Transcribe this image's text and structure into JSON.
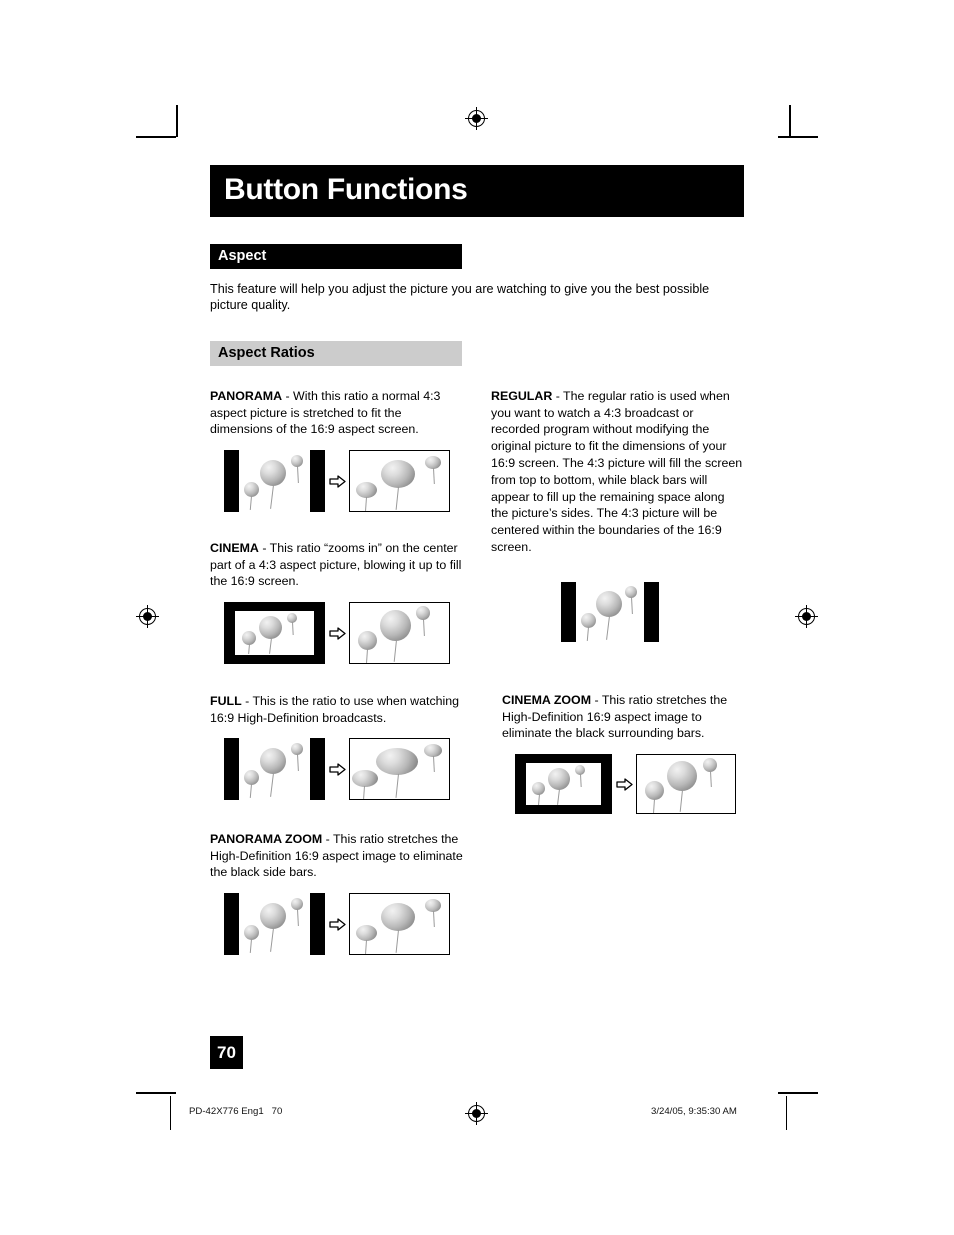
{
  "document": {
    "title": "Button Functions",
    "page_number": "70"
  },
  "sections": {
    "aspect_heading": "Aspect",
    "aspect_intro": "This feature will help you adjust the picture you are watching to give you the best possible picture quality.",
    "aspect_ratios_heading": "Aspect Ratios"
  },
  "ratios": {
    "panorama": {
      "term": "PANORAMA",
      "body": " - With this ratio a normal 4:3 aspect picture is stretched to fit the dimensions of the 16:9 aspect screen."
    },
    "cinema": {
      "term": "CINEMA",
      "body": " - This ratio “zooms in” on the center part of a 4:3 aspect picture, blowing it up to fill the 16:9 screen."
    },
    "full": {
      "term": "FULL",
      "body": " - This is the ratio to use when watching 16:9 High-Definition broadcasts."
    },
    "panorama_zoom": {
      "term": "PANORAMA ZOOM",
      "body": " - This ratio stretches the High-Definition 16:9 aspect image to eliminate the black side bars."
    },
    "regular": {
      "term": "REGULAR",
      "body": " - The regular ratio is used when you want to watch a 4:3 broadcast or recorded program without modifying the original picture to fit the dimensions of your 16:9 screen. The 4:3 picture will fill the screen from top to bottom, while black bars will appear to fill up the remaining space along the picture’s sides. The 4:3 picture will be centered within the boundaries of the 16:9 screen."
    },
    "cinema_zoom": {
      "term": "CINEMA ZOOM",
      "body": " - This ratio stretches the High-Definition 16:9 aspect image to eliminate the black surrounding bars."
    }
  },
  "footer": {
    "left": "PD-42X776 Eng1   70",
    "right": "3/24/05, 9:35:30 AM"
  },
  "colors": {
    "bar_dark": "#000000",
    "bar_light": "#cccccc",
    "page_background": "#ffffff"
  }
}
